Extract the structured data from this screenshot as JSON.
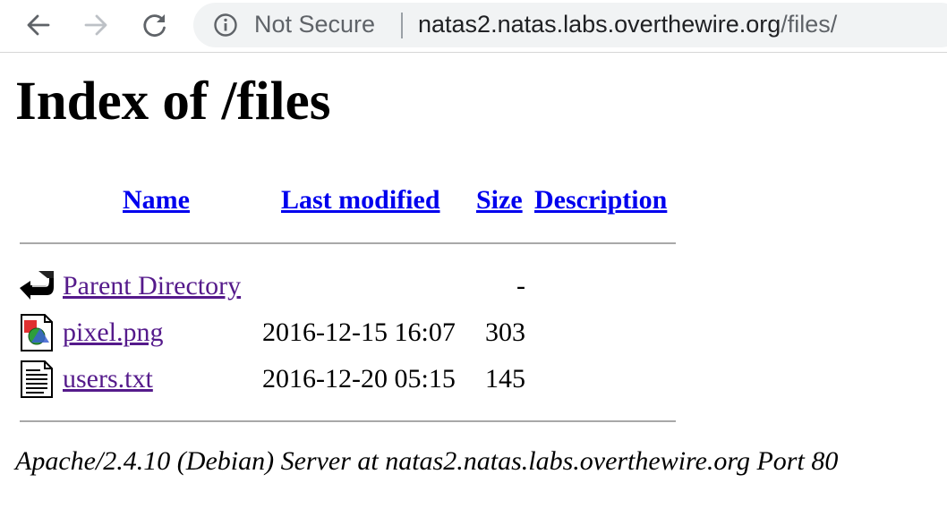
{
  "browser": {
    "security_label": "Not Secure",
    "url_host": "natas2.natas.labs.overthewire.org",
    "url_path": "/files/"
  },
  "page": {
    "title": "Index of /files",
    "columns": {
      "name": "Name",
      "last_modified": "Last modified",
      "size": "Size",
      "description": "Description"
    },
    "rows": [
      {
        "icon": "back-folder-icon",
        "name": "Parent Directory",
        "modified": "",
        "size": "-"
      },
      {
        "icon": "image-file-icon",
        "name": "pixel.png",
        "modified": "2016-12-15 16:07",
        "size": "303"
      },
      {
        "icon": "text-file-icon",
        "name": "users.txt",
        "modified": "2016-12-20 05:15",
        "size": "145"
      }
    ],
    "footer": "Apache/2.4.10 (Debian) Server at natas2.natas.labs.overthewire.org Port 80"
  },
  "colors": {
    "link_visited": "#551a8b",
    "link_unvisited": "#0000ee",
    "omnibox_bg": "#f1f3f4"
  }
}
